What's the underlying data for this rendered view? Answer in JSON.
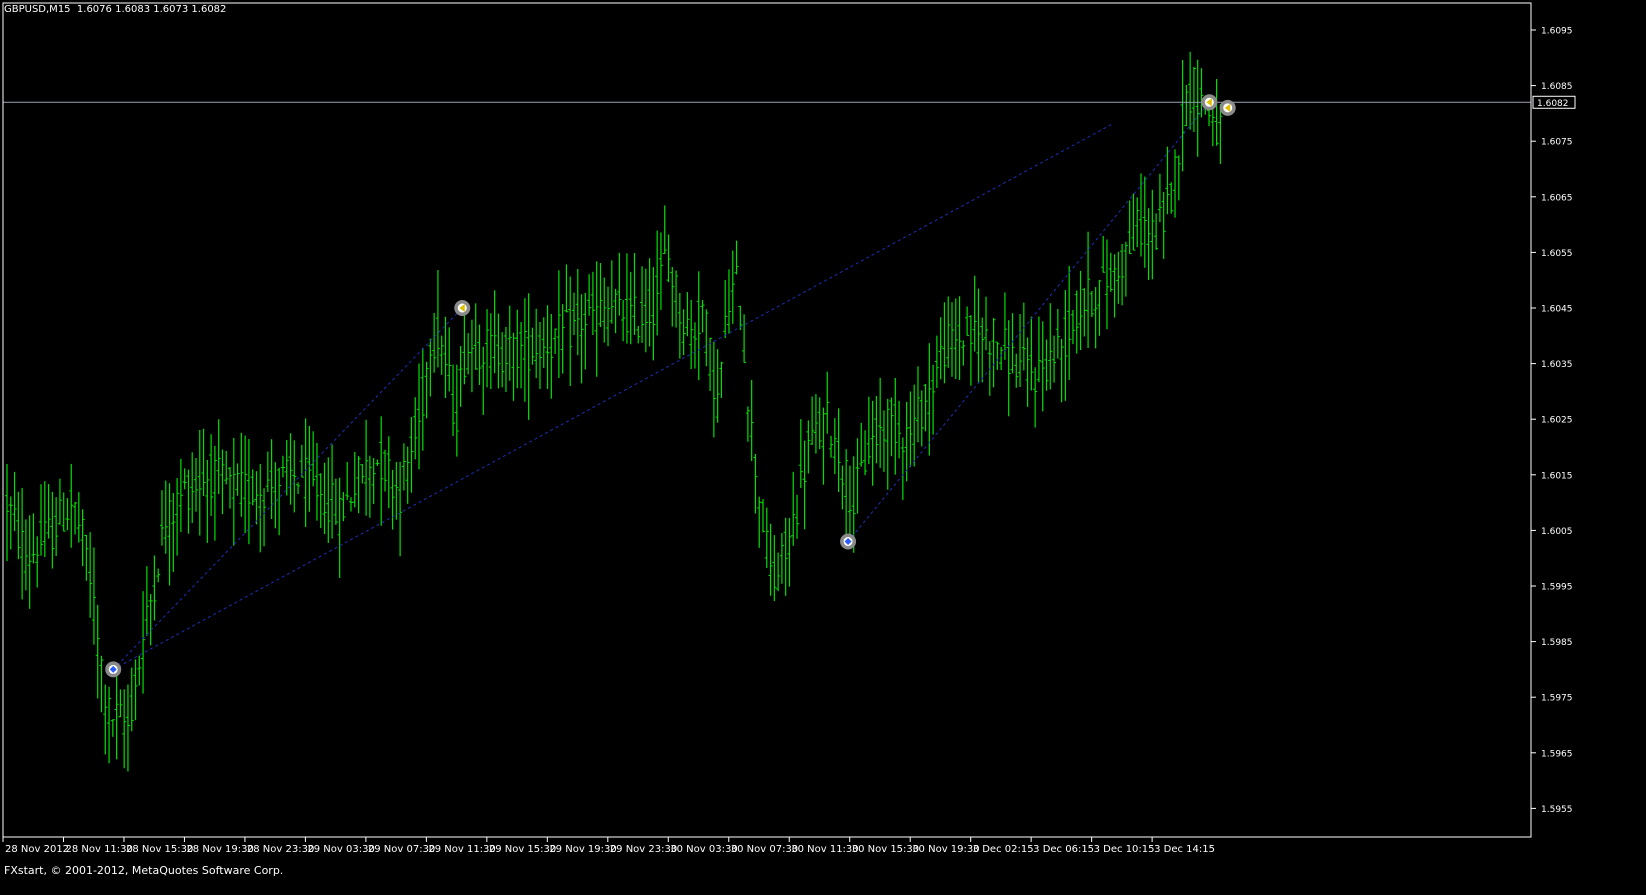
{
  "header": {
    "symbol": "GBPUSD,M15",
    "ohlc": "1.6076 1.6083 1.6073 1.6082"
  },
  "footer": {
    "copyright": "FXstart, © 2001-2012, MetaQuotes Software Corp."
  },
  "colors": {
    "background": "#000000",
    "bars": "#00e000",
    "frame": "#ffffff",
    "zigzag": "#1e2eb8",
    "bid_line": "#9aa2b6",
    "marker_ring": "#8a8a8a",
    "marker_arrow": "#e0c000",
    "marker_diamond": "#2a5cff"
  },
  "chart_data": {
    "type": "ohlc",
    "symbol": "GBPUSD",
    "timeframe": "M15",
    "ylim": [
      1.595,
      1.61
    ],
    "y_ticks": [
      "1.6095",
      "1.6085",
      "1.6075",
      "1.6065",
      "1.6055",
      "1.6045",
      "1.6035",
      "1.6025",
      "1.6015",
      "1.6005",
      "1.5995",
      "1.5985",
      "1.5975",
      "1.5965",
      "1.5955"
    ],
    "current_price": "1.6082",
    "x_labels": [
      "28 Nov 2012",
      "28 Nov 11:30",
      "28 Nov 15:30",
      "28 Nov 19:30",
      "28 Nov 23:30",
      "29 Nov 03:30",
      "29 Nov 07:30",
      "29 Nov 11:30",
      "29 Nov 15:30",
      "29 Nov 19:30",
      "29 Nov 23:30",
      "30 Nov 03:30",
      "30 Nov 07:30",
      "30 Nov 11:30",
      "30 Nov 15:30",
      "30 Nov 19:30",
      "3 Dec 02:15",
      "3 Dec 06:15",
      "3 Dec 10:15",
      "3 Dec 14:15"
    ],
    "bars_per_label": 16,
    "total_bars": 325,
    "price_path": [
      [
        0,
        1.601
      ],
      [
        8,
        1.6
      ],
      [
        18,
        1.6005
      ],
      [
        26,
        1.601
      ],
      [
        32,
        1.6
      ],
      [
        36,
        1.5985
      ],
      [
        40,
        1.5972
      ],
      [
        48,
        1.597
      ],
      [
        54,
        1.5985
      ],
      [
        62,
        1.6005
      ],
      [
        70,
        1.6012
      ],
      [
        80,
        1.6015
      ],
      [
        92,
        1.6012
      ],
      [
        104,
        1.6013
      ],
      [
        116,
        1.6015
      ],
      [
        124,
        1.6012
      ],
      [
        132,
        1.6008
      ],
      [
        140,
        1.6015
      ],
      [
        148,
        1.6018
      ],
      [
        156,
        1.6012
      ],
      [
        164,
        1.6025
      ],
      [
        168,
        1.604
      ],
      [
        172,
        1.604
      ],
      [
        178,
        1.6025
      ],
      [
        182,
        1.6038
      ],
      [
        190,
        1.6038
      ],
      [
        200,
        1.6037
      ],
      [
        210,
        1.6038
      ],
      [
        220,
        1.604
      ],
      [
        230,
        1.6043
      ],
      [
        240,
        1.6045
      ],
      [
        250,
        1.6043
      ],
      [
        256,
        1.6045
      ],
      [
        262,
        1.6055
      ],
      [
        268,
        1.6043
      ],
      [
        272,
        1.604
      ],
      [
        276,
        1.6045
      ],
      [
        282,
        1.6028
      ],
      [
        286,
        1.6045
      ],
      [
        290,
        1.605
      ],
      [
        296,
        1.602
      ],
      [
        302,
        1.6
      ],
      [
        304,
        1.5995
      ],
      [
        310,
        1.6002
      ],
      [
        318,
        1.602
      ],
      [
        326,
        1.6025
      ],
      [
        336,
        1.601
      ],
      [
        342,
        1.602
      ],
      [
        350,
        1.6025
      ],
      [
        358,
        1.6022
      ],
      [
        366,
        1.603
      ],
      [
        372,
        1.6038
      ],
      [
        380,
        1.604
      ],
      [
        392,
        1.604
      ],
      [
        400,
        1.6035
      ],
      [
        408,
        1.6033
      ],
      [
        418,
        1.6038
      ],
      [
        426,
        1.6045
      ],
      [
        432,
        1.6048
      ],
      [
        438,
        1.605
      ],
      [
        444,
        1.6055
      ],
      [
        450,
        1.606
      ],
      [
        456,
        1.6058
      ],
      [
        462,
        1.6065
      ],
      [
        466,
        1.6078
      ],
      [
        470,
        1.6085
      ],
      [
        474,
        1.6083
      ],
      [
        478,
        1.608
      ],
      [
        482,
        1.6075
      ],
      [
        486,
        1.6082
      ]
    ],
    "zigzag_points": [
      {
        "index": 18,
        "price": 1.598
      },
      {
        "index": 75,
        "price": 1.6045
      },
      {
        "index": 138,
        "price": 1.6003
      },
      {
        "index": 197,
        "price": 1.6082
      },
      {
        "index": 200,
        "price": 1.6081
      }
    ],
    "zigzag_segments": [
      [
        {
          "index": 18,
          "price": 1.598
        },
        {
          "index": 75,
          "price": 1.6045
        }
      ],
      [
        {
          "index": 18,
          "price": 1.598
        },
        {
          "index": 181,
          "price": 1.6078
        }
      ],
      [
        {
          "index": 138,
          "price": 1.6003
        },
        {
          "index": 197,
          "price": 1.6082
        }
      ]
    ],
    "markers": [
      {
        "index": 18,
        "price": 1.598,
        "kind": "low"
      },
      {
        "index": 75,
        "price": 1.6045,
        "kind": "high"
      },
      {
        "index": 138,
        "price": 1.6003,
        "kind": "low"
      },
      {
        "index": 197,
        "price": 1.6082,
        "kind": "high"
      },
      {
        "index": 200,
        "price": 1.6081,
        "kind": "high"
      }
    ],
    "grid": false
  }
}
